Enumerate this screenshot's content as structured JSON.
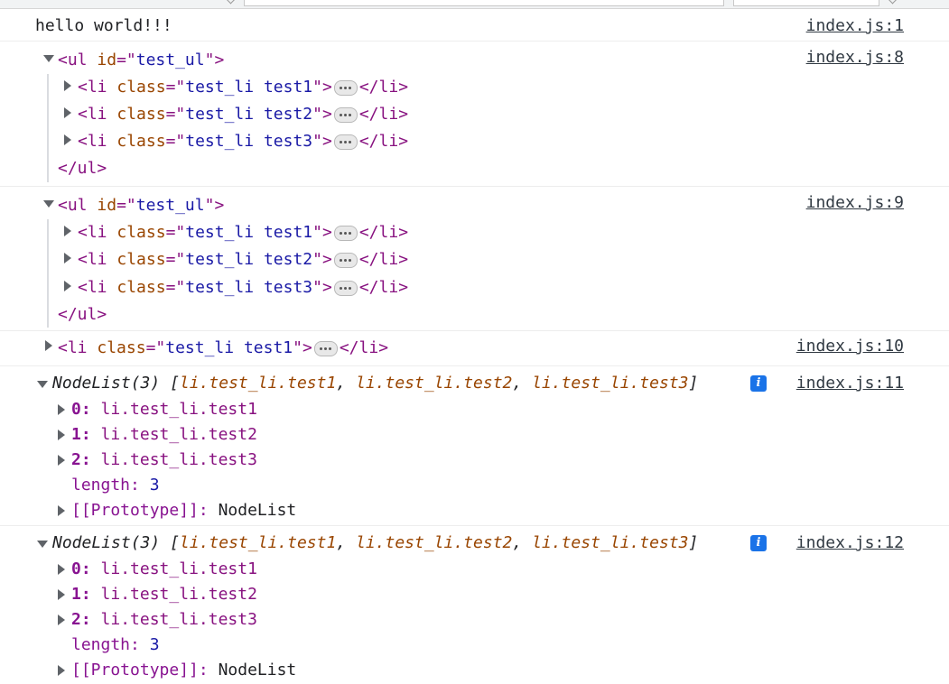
{
  "console": {
    "messages": [
      {
        "text": "hello world!!!",
        "source": "index.js:1"
      },
      {
        "source": "index.js:8",
        "open": "<ul id=\"test_ul\">",
        "ul_tag": "ul",
        "ul_attr": "id",
        "ul_val": "test_ul",
        "items": [
          {
            "cls": "test_li test1"
          },
          {
            "cls": "test_li test2"
          },
          {
            "cls": "test_li test3"
          }
        ],
        "li_tag": "li",
        "li_attr": "class",
        "close": "</ul>"
      },
      {
        "source": "index.js:9",
        "ul_tag": "ul",
        "ul_attr": "id",
        "ul_val": "test_ul",
        "items": [
          {
            "cls": "test_li test1"
          },
          {
            "cls": "test_li test2"
          },
          {
            "cls": "test_li test3"
          }
        ],
        "li_tag": "li",
        "li_attr": "class",
        "close": "</ul>"
      },
      {
        "source": "index.js:10",
        "li_tag": "li",
        "li_attr": "class",
        "li_val": "test_li test1"
      },
      {
        "source": "index.js:11",
        "summary_name": "NodeList(3)",
        "summary_items": [
          "li.test_li.test1",
          "li.test_li.test2",
          "li.test_li.test3"
        ],
        "entries": [
          {
            "key": "0",
            "value": "li.test_li.test1"
          },
          {
            "key": "1",
            "value": "li.test_li.test2"
          },
          {
            "key": "2",
            "value": "li.test_li.test3"
          }
        ],
        "length_key": "length",
        "length_value": "3",
        "proto_key": "[[Prototype]]",
        "proto_value": "NodeList",
        "info_icon": "info-icon"
      },
      {
        "source": "index.js:12",
        "summary_name": "NodeList(3)",
        "summary_items": [
          "li.test_li.test1",
          "li.test_li.test2",
          "li.test_li.test3"
        ],
        "entries": [
          {
            "key": "0",
            "value": "li.test_li.test1"
          },
          {
            "key": "1",
            "value": "li.test_li.test2"
          },
          {
            "key": "2",
            "value": "li.test_li.test3"
          }
        ],
        "length_key": "length",
        "length_value": "3",
        "proto_key": "[[Prototype]]",
        "proto_value": "NodeList",
        "info_icon": "info-icon"
      }
    ]
  },
  "colors": {
    "tag": "#881280",
    "attr": "#994500",
    "value": "#1a1aa6",
    "link": "#303942",
    "info": "#1a73e8"
  }
}
